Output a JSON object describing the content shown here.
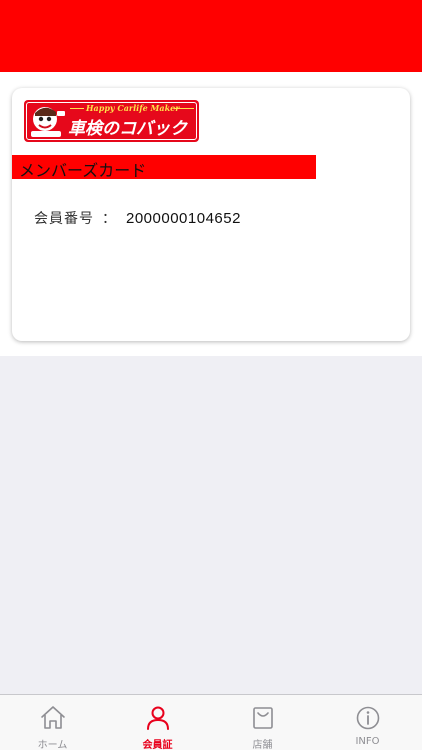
{
  "logo": {
    "tagline": "Happy Carlife Maker",
    "name": "車検のコバック",
    "brand_color": "#e6081b",
    "accent_color": "#ffe14a"
  },
  "card": {
    "title": "メンバーズカード",
    "member_label": "会員番号",
    "separator": "：",
    "member_number": "2000000104652"
  },
  "tabbar": {
    "active_color": "#e8001c",
    "inactive_color": "#8e8e93",
    "items": [
      {
        "label": "ホーム",
        "icon": "home-icon",
        "active": false
      },
      {
        "label": "会員証",
        "icon": "person-icon",
        "active": true
      },
      {
        "label": "店舗",
        "icon": "shopping-bag-icon",
        "active": false
      },
      {
        "label": "INFO",
        "icon": "info-icon",
        "active": false
      }
    ]
  }
}
